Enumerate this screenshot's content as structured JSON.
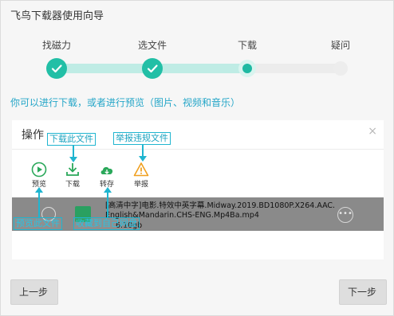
{
  "window": {
    "title": "飞鸟下载器使用向导"
  },
  "steps": [
    {
      "label": "找磁力",
      "state": "done"
    },
    {
      "label": "选文件",
      "state": "done"
    },
    {
      "label": "下载",
      "state": "current"
    },
    {
      "label": "疑问",
      "state": "pending"
    }
  ],
  "hint": "你可以进行下载，或者进行预览（图片、视频和音乐）",
  "panel": {
    "title": "操作",
    "close": "×",
    "actions": [
      {
        "label": "预览",
        "icon": "play-circle-icon"
      },
      {
        "label": "下载",
        "icon": "download-icon"
      },
      {
        "label": "转存",
        "icon": "cloud-save-icon"
      },
      {
        "label": "举报",
        "icon": "warning-icon"
      }
    ],
    "file": {
      "name": "[高清中字]电影.特效中英字幕.Midway.2019.BD1080P.X264.AAC.English&Mandarin.CHS-ENG.Mp4Ba.mp4",
      "size": "6.10gb",
      "more": "•••"
    }
  },
  "annotations": {
    "download_file": "下载此文件",
    "report_file": "举报违规文件",
    "preview_file": "预览此文件",
    "save_to_cloud": "收藏到自己网盘"
  },
  "footer": {
    "prev": "上一步",
    "next": "下一步"
  },
  "colors": {
    "accent": "#22bfa6",
    "hint": "#25a6c8",
    "annotation": "#1fb5d0"
  }
}
